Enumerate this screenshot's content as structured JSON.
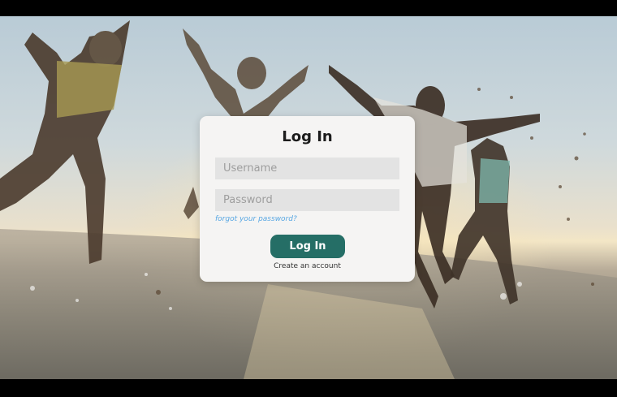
{
  "background": {
    "icon": "beach-photo"
  },
  "login": {
    "title": "Log In",
    "username_placeholder": "Username",
    "password_placeholder": "Password",
    "forgot_label": "forgot your password?",
    "submit_label": "Log In",
    "create_label": "Create an account"
  },
  "colors": {
    "accent": "#256e66",
    "link": "#58a7e3",
    "card": "#f5f4f3",
    "field": "#e3e3e3"
  }
}
